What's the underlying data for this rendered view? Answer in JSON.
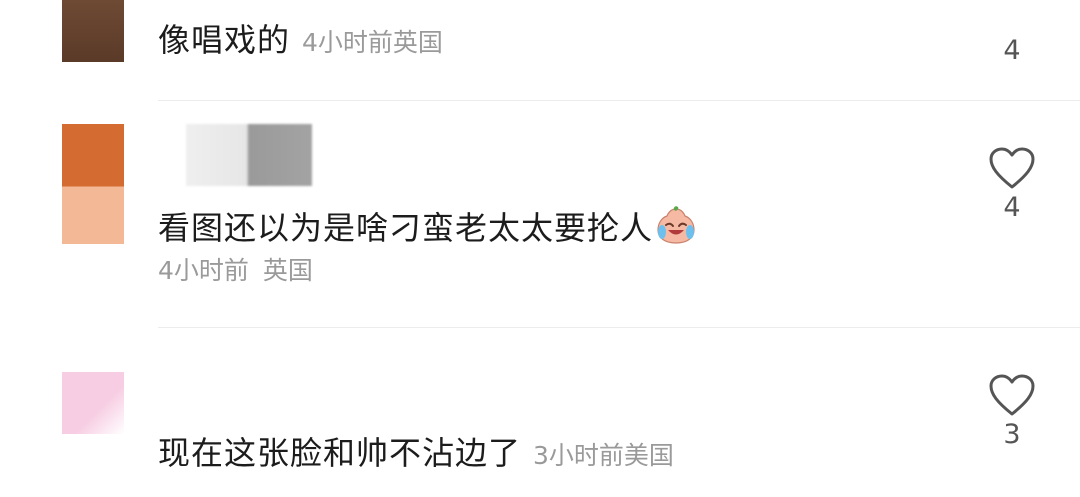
{
  "comments": [
    {
      "text": "像唱戏的",
      "time": "4小时前",
      "location": "英国",
      "likes": "4",
      "avatar_colors": [
        "#6e4a34",
        "#5a3a28"
      ]
    },
    {
      "text": "看图还以为是啥刁蛮老太太要抡人",
      "emoji": "crying-laughing-peach-emoji",
      "time": "4小时前",
      "location": "英国",
      "likes": "4",
      "avatar_colors": [
        "#d46c31",
        "#f3b996"
      ]
    },
    {
      "text": "现在这张脸和帅不沾边了",
      "time": "3小时前",
      "location": "美国",
      "likes": "3",
      "avatar_colors": [
        "#f7cde3",
        "#ffffff"
      ]
    }
  ],
  "icons": {
    "like": "heart-outline-icon"
  },
  "colors": {
    "text": "#1c1c1c",
    "meta": "#9a9a9a",
    "divider": "#ececec",
    "heart": "#555555"
  }
}
